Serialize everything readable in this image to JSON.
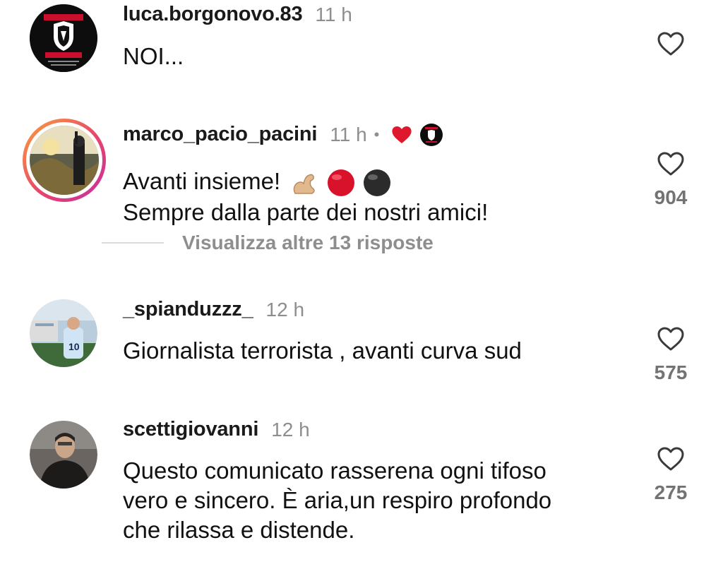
{
  "comments": [
    {
      "username": "luca.borgonovo.83",
      "time": "11 h",
      "lines": [
        "NOI..."
      ],
      "likes": "",
      "avatar": {
        "bg": "#0d0d0d",
        "accent": "#c8102e"
      }
    },
    {
      "username": "marco_pacio_pacini",
      "time": "11 h",
      "dot": "•",
      "lines": [
        "Avanti insieme!",
        "Sempre dalla parte dei nostri amici!"
      ],
      "likes": "904",
      "avatar": {
        "bg": "#6b6b52",
        "accent": "#d9a441"
      },
      "view_replies": "Visualizza altre 13 risposte"
    },
    {
      "username": "_spianduzzz_",
      "time": "12 h",
      "lines": [
        "Giornalista terrorista , avanti curva sud"
      ],
      "likes": "575",
      "avatar": {
        "bg": "#9db8cc",
        "accent": "#2e4a2b"
      }
    },
    {
      "username": "scettigiovanni",
      "time": "12 h",
      "lines": [
        "Questo comunicato rasserena ogni tifoso",
        "vero e sincero. È aria,un respiro profondo",
        "che rilassa e distende."
      ],
      "likes": "275",
      "avatar": {
        "bg": "#4a4540",
        "accent": "#c9a58a"
      }
    }
  ],
  "icons": {
    "like": "heart-outline-icon",
    "author_liked": "heart-filled-icon",
    "author_badge": "club-logo-icon"
  },
  "colors": {
    "username": "#1a1a1a",
    "meta": "#8e8e8e",
    "like_count": "#737373",
    "heart_red": "#e0182d",
    "story_ring_start": "#f9a13a",
    "story_ring_end": "#c42fa3"
  }
}
